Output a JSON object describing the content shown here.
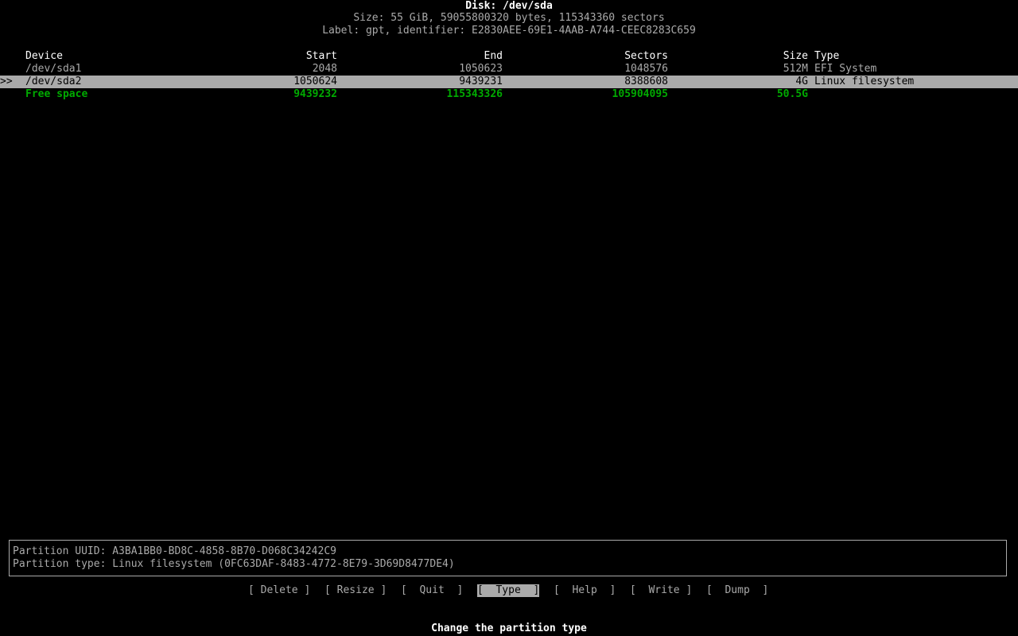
{
  "header": {
    "title": "Disk: /dev/sda",
    "size_line": "Size: 55 GiB, 59055800320 bytes, 115343360 sectors",
    "label_line": "Label: gpt, identifier: E2830AEE-69E1-4AAB-A744-CEEC8283C659"
  },
  "table": {
    "columns": [
      "Device",
      "Start",
      "End",
      "Sectors",
      "Size",
      "Type"
    ],
    "rows": [
      {
        "marker": "",
        "device": "/dev/sda1",
        "start": "2048",
        "end": "1050623",
        "sectors": "1048576",
        "size": "512M",
        "type": "EFI System"
      },
      {
        "marker": ">>",
        "device": "/dev/sda2",
        "start": "1050624",
        "end": "9439231",
        "sectors": "8388608",
        "size": "4G",
        "type": "Linux filesystem"
      },
      {
        "marker": "",
        "device": "Free space",
        "start": "9439232",
        "end": "115343326",
        "sectors": "105904095",
        "size": "50.5G",
        "type": ""
      }
    ],
    "selected_row": 1
  },
  "info": {
    "uuid_line": "Partition UUID: A3BA1BB0-BD8C-4858-8B70-D068C34242C9",
    "type_line": "Partition type: Linux filesystem (0FC63DAF-8483-4772-8E79-3D69D8477DE4)"
  },
  "menu": {
    "items": [
      "[ Delete ]",
      "[ Resize ]",
      "[  Quit  ]",
      "[  Type  ]",
      "[  Help  ]",
      "[  Write ]",
      "[  Dump  ]"
    ],
    "selected": 3
  },
  "status": "Change the partition type",
  "colors": {
    "background": "#000000",
    "text": "#aaaaaa",
    "highlight_bg": "#aaaaaa",
    "free_space": "#00aa00",
    "bold_text": "#ffffff"
  }
}
